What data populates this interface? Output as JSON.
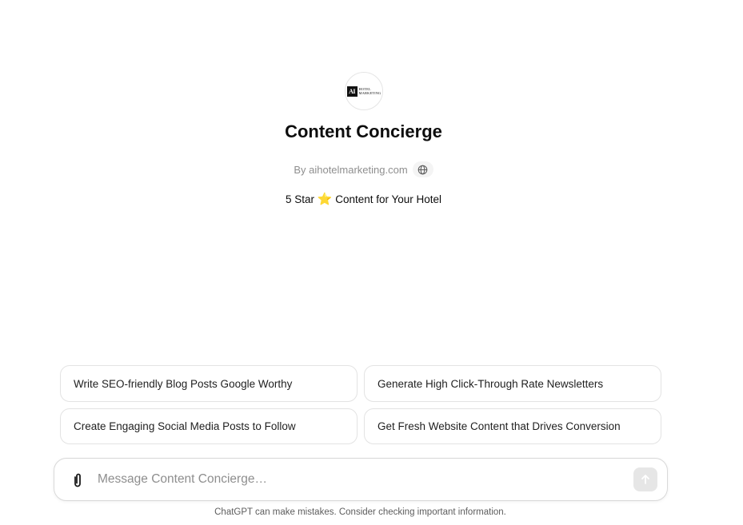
{
  "gpt": {
    "logo_mark": "AI",
    "logo_line1": "HOTEL",
    "logo_line2": "MARKETING",
    "title": "Content Concierge",
    "byline": "By aihotelmarketing.com",
    "tagline_before": "5 Star",
    "tagline_after": "Content for Your Hotel"
  },
  "icons": {
    "website": "globe-icon",
    "tagline_emoji": "star-icon",
    "attach": "paperclip-icon",
    "send": "arrow-up-icon"
  },
  "suggestions": [
    "Write SEO-friendly Blog Posts Google Worthy",
    "Generate High Click-Through Rate Newsletters",
    "Create Engaging Social Media Posts to Follow",
    "Get Fresh Website Content that Drives Conversion"
  ],
  "composer": {
    "placeholder": "Message Content Concierge…",
    "value": ""
  },
  "footer": {
    "disclaimer": "ChatGPT can make mistakes. Consider checking important information."
  },
  "colors": {
    "star": "#f5c518",
    "send_disabled": "#e6e6e6"
  }
}
